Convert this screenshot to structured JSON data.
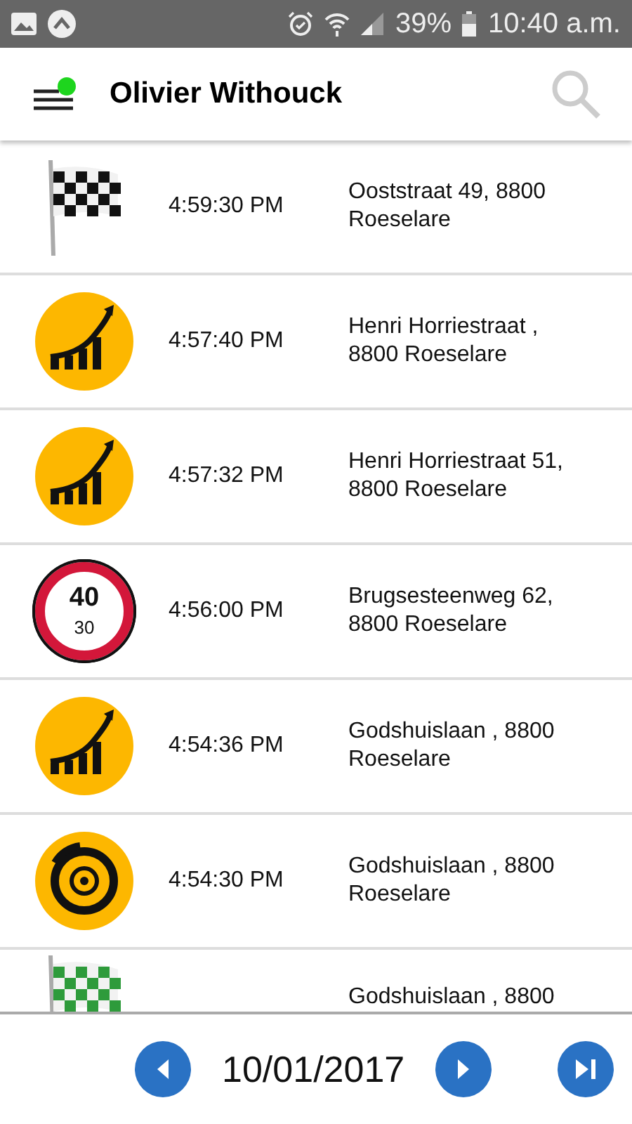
{
  "status_bar": {
    "battery": "39%",
    "time": "10:40 a.m."
  },
  "header": {
    "title": "Olivier Withouck",
    "notification": true
  },
  "events": [
    {
      "kind": "finish",
      "time": "4:59:30 PM",
      "address": "Ooststraat 49, 8800 Roeselare"
    },
    {
      "kind": "acceleration",
      "time": "4:57:40 PM",
      "address": "Henri Horriestraat , 8800 Roeselare"
    },
    {
      "kind": "acceleration",
      "time": "4:57:32 PM",
      "address": "Henri Horriestraat 51, 8800 Roeselare"
    },
    {
      "kind": "speed",
      "limit": "40",
      "speed": "30",
      "time": "4:56:00 PM",
      "address": "Brugsesteenweg 62, 8800 Roeselare"
    },
    {
      "kind": "acceleration",
      "time": "4:54:36 PM",
      "address": "Godshuislaan , 8800 Roeselare"
    },
    {
      "kind": "braking",
      "time": "4:54:30 PM",
      "address": "Godshuislaan , 8800 Roeselare"
    },
    {
      "kind": "start",
      "address": "Godshuislaan , 8800"
    }
  ],
  "footer": {
    "date": "10/01/2017"
  }
}
